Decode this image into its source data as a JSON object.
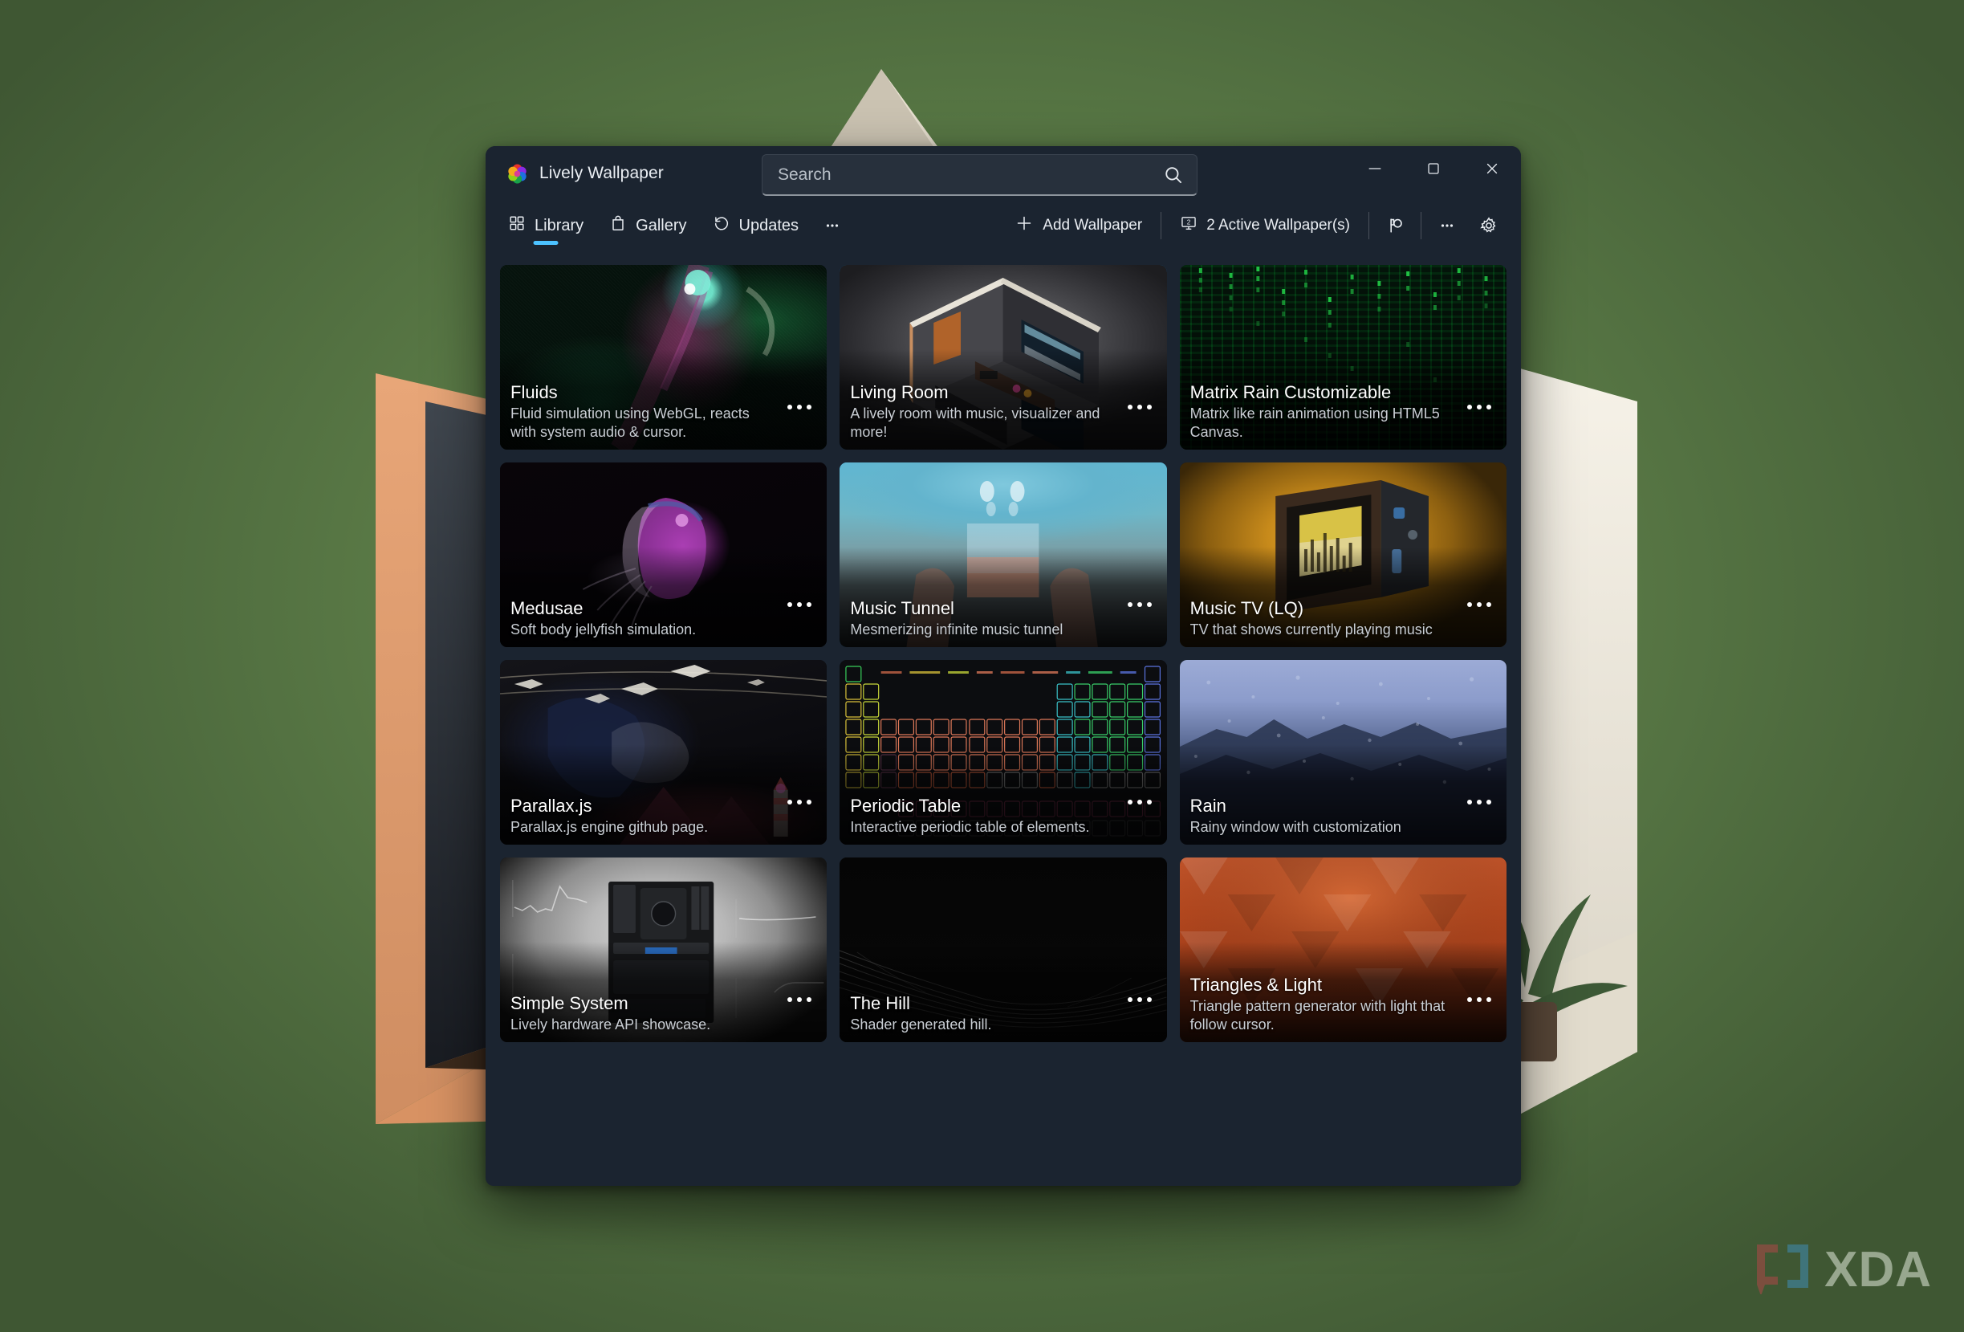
{
  "window": {
    "app_title": "Lively Wallpaper",
    "logo_icon": "lively-color-wheel-icon",
    "controls": {
      "minimize": "minimize-icon",
      "maximize": "maximize-icon",
      "close": "close-icon"
    }
  },
  "search": {
    "placeholder": "Search",
    "value": "",
    "icon": "search-icon"
  },
  "commandbar": {
    "tabs": [
      {
        "label": "Library",
        "icon": "grid-icon",
        "active": true
      },
      {
        "label": "Gallery",
        "icon": "bag-icon",
        "active": false
      },
      {
        "label": "Updates",
        "icon": "history-icon",
        "active": false
      }
    ],
    "overflow_label": "•••",
    "add_wallpaper": {
      "label": "Add Wallpaper",
      "icon": "plus-icon"
    },
    "active_wallpapers": {
      "label": "2 Active Wallpaper(s)",
      "icon": "monitor-2-icon",
      "count": 2
    },
    "layout_button": "screen-layout-icon",
    "more_button": "more-options-icon",
    "settings_button": "gear-icon",
    "accent_color": "#4cc2ff",
    "active_border_color": "#0a84e0"
  },
  "library": {
    "more_dots": "more-dots-icon",
    "cards": [
      {
        "title": "Fluids",
        "description": "Fluid simulation using WebGL, reacts with system audio & cursor.",
        "active": false,
        "thumb_class": "th-fluids"
      },
      {
        "title": "Living Room",
        "description": "A lively room with music, visualizer and more!",
        "active": true,
        "thumb_class": "th-livingroom"
      },
      {
        "title": "Matrix Rain Customizable",
        "description": "Matrix like rain animation using HTML5 Canvas.",
        "active": false,
        "thumb_class": "th-matrix"
      },
      {
        "title": "Medusae",
        "description": "Soft body jellyfish simulation.",
        "active": false,
        "thumb_class": "th-medusae"
      },
      {
        "title": "Music Tunnel",
        "description": "Mesmerizing infinite music tunnel",
        "active": true,
        "thumb_class": "th-musictunnel"
      },
      {
        "title": "Music TV (LQ)",
        "description": "TV that shows currently playing music",
        "active": false,
        "thumb_class": "th-musictv"
      },
      {
        "title": "Parallax.js",
        "description": "Parallax.js engine github page.",
        "active": false,
        "thumb_class": "th-parallax"
      },
      {
        "title": "Periodic Table",
        "description": "Interactive periodic table of elements.",
        "active": false,
        "thumb_class": "th-periodic"
      },
      {
        "title": "Rain",
        "description": "Rainy window with customization",
        "active": false,
        "thumb_class": "th-rain"
      },
      {
        "title": "Simple System",
        "description": "Lively hardware API showcase.",
        "active": false,
        "thumb_class": "th-simplesystem"
      },
      {
        "title": "The Hill",
        "description": "Shader generated hill.",
        "active": false,
        "thumb_class": "th-hill"
      },
      {
        "title": "Triangles & Light",
        "description": "Triangle pattern generator with light that follow cursor.",
        "active": false,
        "thumb_class": "th-triangles"
      }
    ]
  },
  "watermark": {
    "text": "XDA",
    "icon": "xda-bracket-logo"
  },
  "desktop": {
    "background_color": "#60814a"
  }
}
